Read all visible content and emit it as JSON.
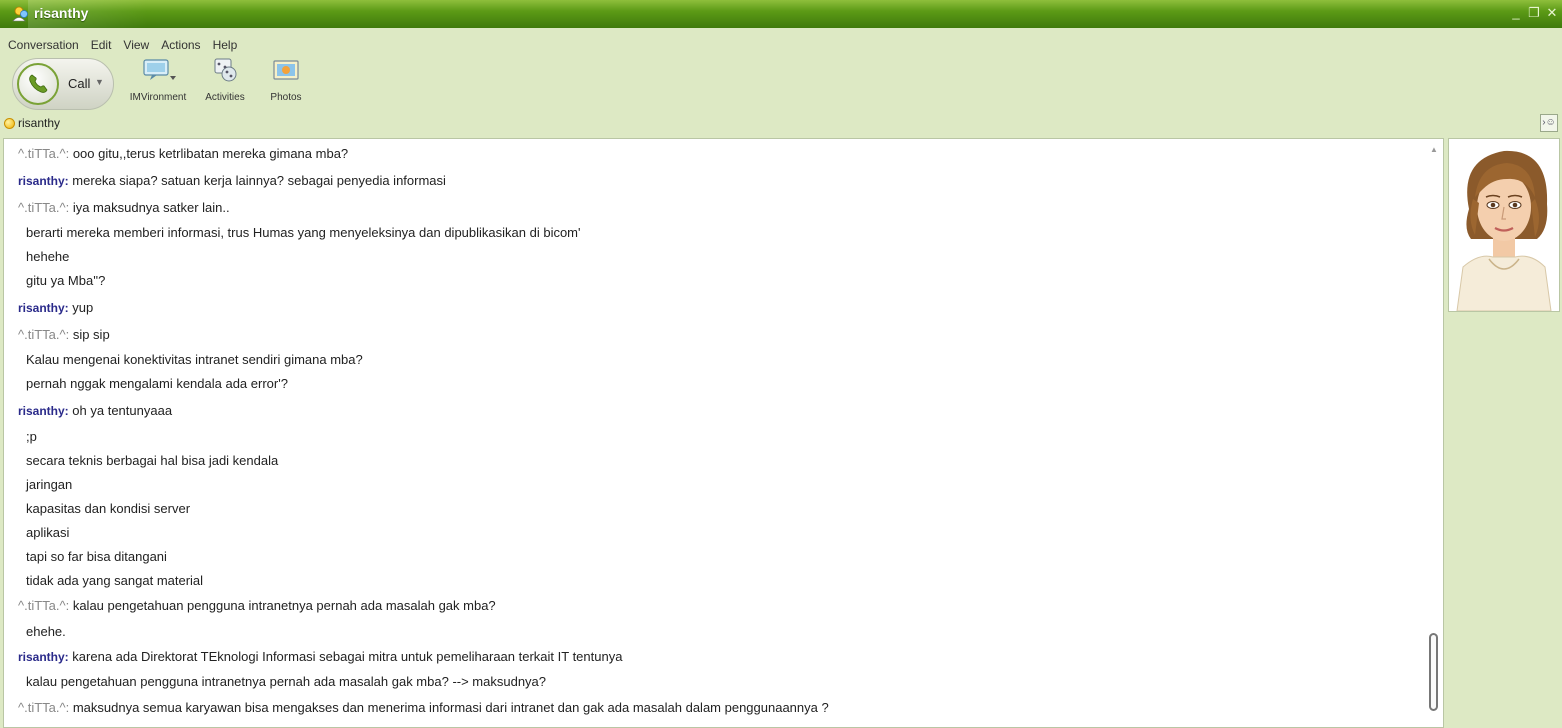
{
  "window": {
    "title": "risanthy",
    "controls": [
      "minimize-icon",
      "restore-icon",
      "close-icon"
    ]
  },
  "menu": [
    "Conversation",
    "Edit",
    "View",
    "Actions",
    "Help"
  ],
  "toolbar": {
    "call_label": "Call",
    "imvironment_label": "IMVironment",
    "activities_label": "Activities",
    "photos_label": "Photos"
  },
  "contact": {
    "name": "risanthy",
    "status_color": "#f0b400"
  },
  "colors": {
    "title_bar": "#5c9a16",
    "window_bg": "#dde9c4",
    "own_sender": "#2a2a8a",
    "other_sender": "#888888"
  },
  "messages": [
    {
      "sender": "^.tiTTa.^:",
      "text": " ooo gitu,,terus ketrlibatan mereka gimana mba?"
    },
    {
      "sender": "risanthy:",
      "text": " mereka siapa? satuan kerja lainnya? sebagai penyedia informasi"
    },
    {
      "sender": "^.tiTTa.^:",
      "text": " iya maksudnya satker lain.."
    },
    {
      "sender": "",
      "text": "berarti mereka memberi informasi, trus Humas yang menyeleksinya dan dipublikasikan di bicom'"
    },
    {
      "sender": "",
      "text": "hehehe"
    },
    {
      "sender": "",
      "text": "gitu ya Mba''?"
    },
    {
      "sender": "risanthy:",
      "text": " yup"
    },
    {
      "sender": "^.tiTTa.^:",
      "text": " sip sip"
    },
    {
      "sender": "",
      "text": "Kalau mengenai konektivitas intranet sendiri gimana mba?"
    },
    {
      "sender": "",
      "text": "pernah nggak mengalami kendala ada error'?"
    },
    {
      "sender": "risanthy:",
      "text": " oh ya tentunyaaa"
    },
    {
      "sender": "",
      "text": ";p"
    },
    {
      "sender": "",
      "text": "secara teknis berbagai hal bisa jadi kendala"
    },
    {
      "sender": "",
      "text": "jaringan"
    },
    {
      "sender": "",
      "text": "kapasitas dan kondisi server"
    },
    {
      "sender": "",
      "text": "aplikasi"
    },
    {
      "sender": "",
      "text": "tapi so far bisa ditangani"
    },
    {
      "sender": "",
      "text": "tidak ada yang sangat material"
    },
    {
      "sender": "^.tiTTa.^:",
      "text": " kalau pengetahuan pengguna intranetnya pernah ada masalah gak mba?"
    },
    {
      "sender": "",
      "text": "ehehe."
    },
    {
      "sender": "risanthy:",
      "text": " karena ada Direktorat TEknologi Informasi sebagai mitra untuk pemeliharaan terkait IT tentunya"
    },
    {
      "sender": "",
      "text": "kalau pengetahuan pengguna intranetnya pernah ada masalah gak mba? --> maksudnya?"
    },
    {
      "sender": "^.tiTTa.^:",
      "text": " maksudnya semua karyawan bisa mengakses dan menerima informasi dari intranet dan gak ada masalah dalam penggunaannya ?"
    }
  ]
}
